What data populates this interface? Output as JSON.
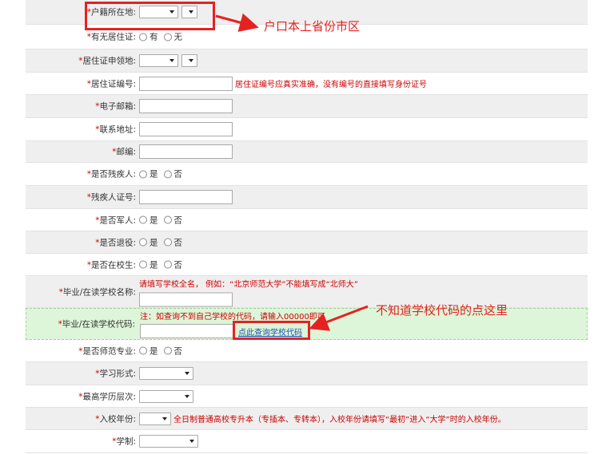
{
  "required_mark": "*",
  "rows": {
    "huji": {
      "label": "户籍所在地:"
    },
    "juzhuzheng": {
      "label": "有无居住证:",
      "opt_yes": "有",
      "opt_no": "无"
    },
    "lingdi": {
      "label": "居住证申领地:"
    },
    "bianhao": {
      "label": "居住证编号:",
      "hint": "居住证编号应真实准确，没有编号的直接填写身份证号"
    },
    "email": {
      "label": "电子邮箱:"
    },
    "address": {
      "label": "联系地址:"
    },
    "postcode": {
      "label": "邮编:"
    },
    "disabled": {
      "label": "是否残疾人:",
      "opt_yes": "是",
      "opt_no": "否"
    },
    "disabled_no": {
      "label": "残疾人证号:"
    },
    "soldier": {
      "label": "是否军人:",
      "opt_yes": "是",
      "opt_no": "否"
    },
    "veteran": {
      "label": "是否退役:",
      "opt_yes": "是",
      "opt_no": "否"
    },
    "student": {
      "label": "是否在校生:",
      "opt_yes": "是",
      "opt_no": "否"
    },
    "school_name": {
      "label": "毕业/在读学校名称:",
      "hint": "请填写学校全名， 例如：“北京师范大学”不能填写成“北师大”"
    },
    "school_code": {
      "label": "毕业/在读学校代码:",
      "hint": "注：如查询不到自己学校的代码，请输入00000即可",
      "button": "点此查询学校代码"
    },
    "normal": {
      "label": "是否师范专业:",
      "opt_yes": "是",
      "opt_no": "否"
    },
    "study_form": {
      "label": "学习形式:"
    },
    "edu_level": {
      "label": "最高学历层次:"
    },
    "enroll_year": {
      "label": "入校年份:",
      "hint": "全日制普通高校专升本（专插本、专转本），入校年份请填写“最初”进入“大学”时的入校年份。"
    },
    "duration": {
      "label": "学制:"
    }
  },
  "annotations": {
    "huji_note": "户口本上省份市区",
    "code_note": "不知道学校代码的点这里",
    "color": "#e52222"
  },
  "colors": {
    "required": "#d00000",
    "hint": "#cc0000",
    "highlight_row": "#ddf5d8",
    "alt_row": "#efefef"
  }
}
